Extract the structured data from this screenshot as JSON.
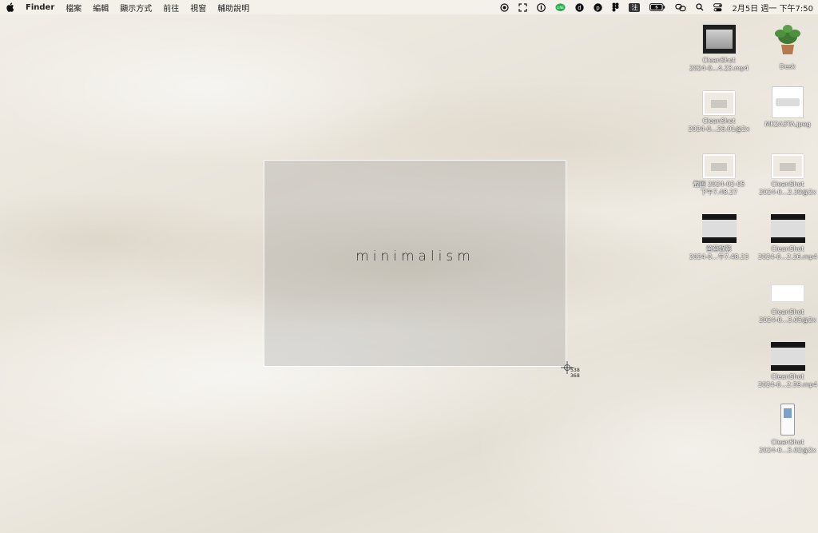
{
  "menubar": {
    "app": "Finder",
    "items": [
      "檔案",
      "編輯",
      "顯示方式",
      "前往",
      "視窗",
      "輔助說明"
    ],
    "input_method": "注",
    "clock": "2月5日 週一  下午7:50"
  },
  "selection": {
    "text": "minimalism",
    "coord_x": "538",
    "coord_y": "368"
  },
  "desktop_items": [
    {
      "line1": "CleanShot",
      "line2": "2024-0...4.23.mp4",
      "kind": "video"
    },
    {
      "line1": "Desk",
      "line2": "",
      "kind": "plant"
    },
    {
      "line1": "CleanShot",
      "line2": "2024-0...26.01@2x",
      "kind": "shot"
    },
    {
      "line1": "MK2A3TA.jpeg",
      "line2": "",
      "kind": "keyboard"
    },
    {
      "line1": "截圖 2024-02-05",
      "line2": "下午7.48.27",
      "kind": "shot"
    },
    {
      "line1": "CleanShot",
      "line2": "2024-0...2.39@2x",
      "kind": "shot"
    },
    {
      "line1": "螢幕錄影",
      "line2": "2024-0...午7.48.23",
      "kind": "dark"
    },
    {
      "line1": "CleanShot",
      "line2": "2024-0...2.26.mp4",
      "kind": "dark"
    },
    {
      "line1": "CleanShot",
      "line2": "2024-0...3.05@2x",
      "kind": "wide"
    },
    {
      "line1": "CleanShot",
      "line2": "2024-0...2.59.mp4",
      "kind": "dark"
    },
    {
      "line1": "CleanShot",
      "line2": "2024-0...5.02@2x",
      "kind": "phone"
    }
  ]
}
